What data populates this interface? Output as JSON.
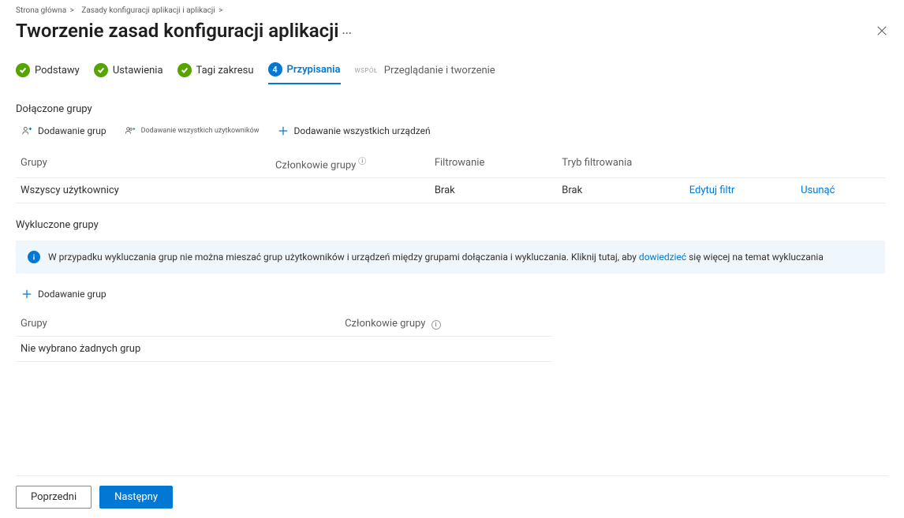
{
  "breadcrumb": {
    "home": "Strona główna",
    "sep": ">",
    "parent": "Zasady konfiguracji aplikacji i aplikacji",
    "parent_sep": ">"
  },
  "page_title": "Tworzenie zasad konfiguracji aplikacji",
  "page_title_suffix": "···",
  "steps": [
    {
      "label": "Podstawy",
      "state": "done"
    },
    {
      "label": "Ustawienia",
      "state": "done"
    },
    {
      "label": "Tagi zakresu",
      "state": "done"
    },
    {
      "num": "4",
      "label": "Przypisania",
      "state": "current"
    },
    {
      "num": "WSPÓŁ",
      "label": "Przeglądanie i tworzenie",
      "state": "future"
    }
  ],
  "included": {
    "section_label": "Dołączone grupy",
    "actions": {
      "add_groups": "Dodawanie grup",
      "add_all_users": "Dodawanie wszystkich użytkowników",
      "add_all_devices": "Dodawanie wszystkich urządzeń"
    },
    "columns": {
      "groups": "Grupy",
      "members": "Członkowie grupy",
      "members_info": "ⓘ",
      "filter": "Filtrowanie",
      "filter_mode": "Tryb filtrowania"
    },
    "rows": [
      {
        "group": "Wszyscy użytkownicy",
        "members": "",
        "filter": "Brak",
        "filter_mode": "Brak",
        "edit": "Edytuj filtr",
        "remove": "Usunąć"
      }
    ]
  },
  "excluded": {
    "section_label": "Wykluczone grupy",
    "banner_text_a": "W przypadku wykluczania grup nie można mieszać grup użytkowników i urządzeń między grupami dołączania i wykluczania. Kliknij tutaj, aby ",
    "banner_link": "dowiedzieć",
    "banner_text_b": " się więcej na temat wykluczania",
    "add_groups": "Dodawanie grup",
    "columns": {
      "groups": "Grupy",
      "members": "Członkowie grupy"
    },
    "empty_row": "Nie wybrano żadnych grup"
  },
  "footer": {
    "prev": "Poprzedni",
    "next": "Następny"
  }
}
